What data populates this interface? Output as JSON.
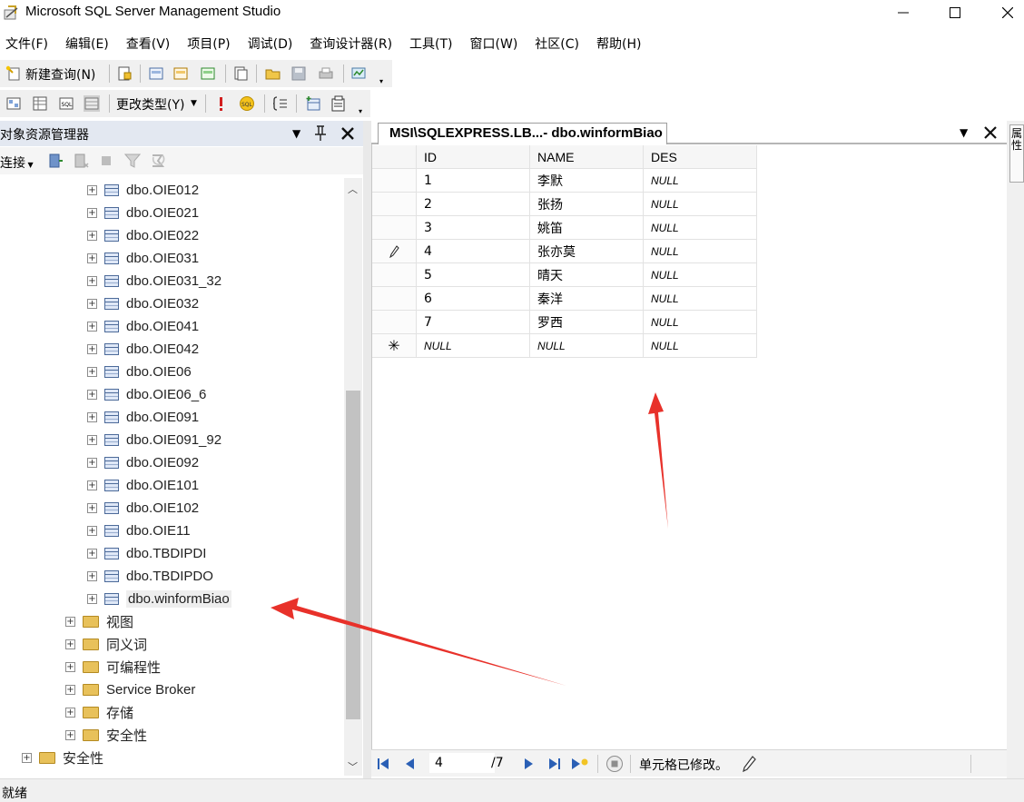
{
  "window": {
    "title": "Microsoft SQL Server Management Studio",
    "minimize": "minimize",
    "maximize": "maximize",
    "close": "close"
  },
  "menu": [
    "文件(F)",
    "编辑(E)",
    "查看(V)",
    "项目(P)",
    "调试(D)",
    "查询设计器(R)",
    "工具(T)",
    "窗口(W)",
    "社区(C)",
    "帮助(H)"
  ],
  "toolbar1": {
    "new_query": "新建查询(N)"
  },
  "toolbar2": {
    "change_type": "更改类型(Y)"
  },
  "object_explorer": {
    "title": "对象资源管理器",
    "connect_label": "连接",
    "tree": [
      {
        "label": "dbo.OIE012",
        "kind": "table"
      },
      {
        "label": "dbo.OIE021",
        "kind": "table"
      },
      {
        "label": "dbo.OIE022",
        "kind": "table"
      },
      {
        "label": "dbo.OIE031",
        "kind": "table"
      },
      {
        "label": "dbo.OIE031_32",
        "kind": "table"
      },
      {
        "label": "dbo.OIE032",
        "kind": "table"
      },
      {
        "label": "dbo.OIE041",
        "kind": "table"
      },
      {
        "label": "dbo.OIE042",
        "kind": "table"
      },
      {
        "label": "dbo.OIE06",
        "kind": "table"
      },
      {
        "label": "dbo.OIE06_6",
        "kind": "table"
      },
      {
        "label": "dbo.OIE091",
        "kind": "table"
      },
      {
        "label": "dbo.OIE091_92",
        "kind": "table"
      },
      {
        "label": "dbo.OIE092",
        "kind": "table"
      },
      {
        "label": "dbo.OIE101",
        "kind": "table"
      },
      {
        "label": "dbo.OIE102",
        "kind": "table"
      },
      {
        "label": "dbo.OIE11",
        "kind": "table"
      },
      {
        "label": "dbo.TBDIPDI",
        "kind": "table"
      },
      {
        "label": "dbo.TBDIPDO",
        "kind": "table"
      },
      {
        "label": "dbo.winformBiao",
        "kind": "table",
        "selected": true
      },
      {
        "label": "视图",
        "kind": "folder"
      },
      {
        "label": "同义词",
        "kind": "folder"
      },
      {
        "label": "可编程性",
        "kind": "folder"
      },
      {
        "label": "Service Broker",
        "kind": "folder"
      },
      {
        "label": "存储",
        "kind": "folder"
      },
      {
        "label": "安全性",
        "kind": "folder"
      },
      {
        "label": "安全性",
        "kind": "folder",
        "level": "server"
      }
    ]
  },
  "document": {
    "tab_title": "MSI\\SQLEXPRESS.LB...- dbo.winformBiao",
    "grid": {
      "columns": [
        "ID",
        "NAME",
        "DES"
      ],
      "rows": [
        {
          "marker": "",
          "cells": [
            "1",
            "李默",
            "NULL"
          ]
        },
        {
          "marker": "",
          "cells": [
            "2",
            "张扬",
            "NULL"
          ]
        },
        {
          "marker": "",
          "cells": [
            "3",
            "姚笛",
            "NULL"
          ]
        },
        {
          "marker": "pencil",
          "cells": [
            "4",
            "张亦莫",
            "NULL"
          ]
        },
        {
          "marker": "",
          "cells": [
            "5",
            "晴天",
            "NULL"
          ]
        },
        {
          "marker": "",
          "cells": [
            "6",
            "秦洋",
            "NULL"
          ]
        },
        {
          "marker": "",
          "cells": [
            "7",
            "罗西",
            "NULL"
          ]
        },
        {
          "marker": "new",
          "cells": [
            "NULL",
            "NULL",
            "NULL"
          ]
        }
      ]
    },
    "navigation": {
      "current_record": "4",
      "total_records": "/7",
      "status": "单元格已修改。"
    }
  },
  "right_panel_tab": "属性",
  "statusbar": {
    "text": "就绪"
  },
  "colors": {
    "annotation_arrow": "#e8312a",
    "panel_header": "#e3e8f1"
  }
}
